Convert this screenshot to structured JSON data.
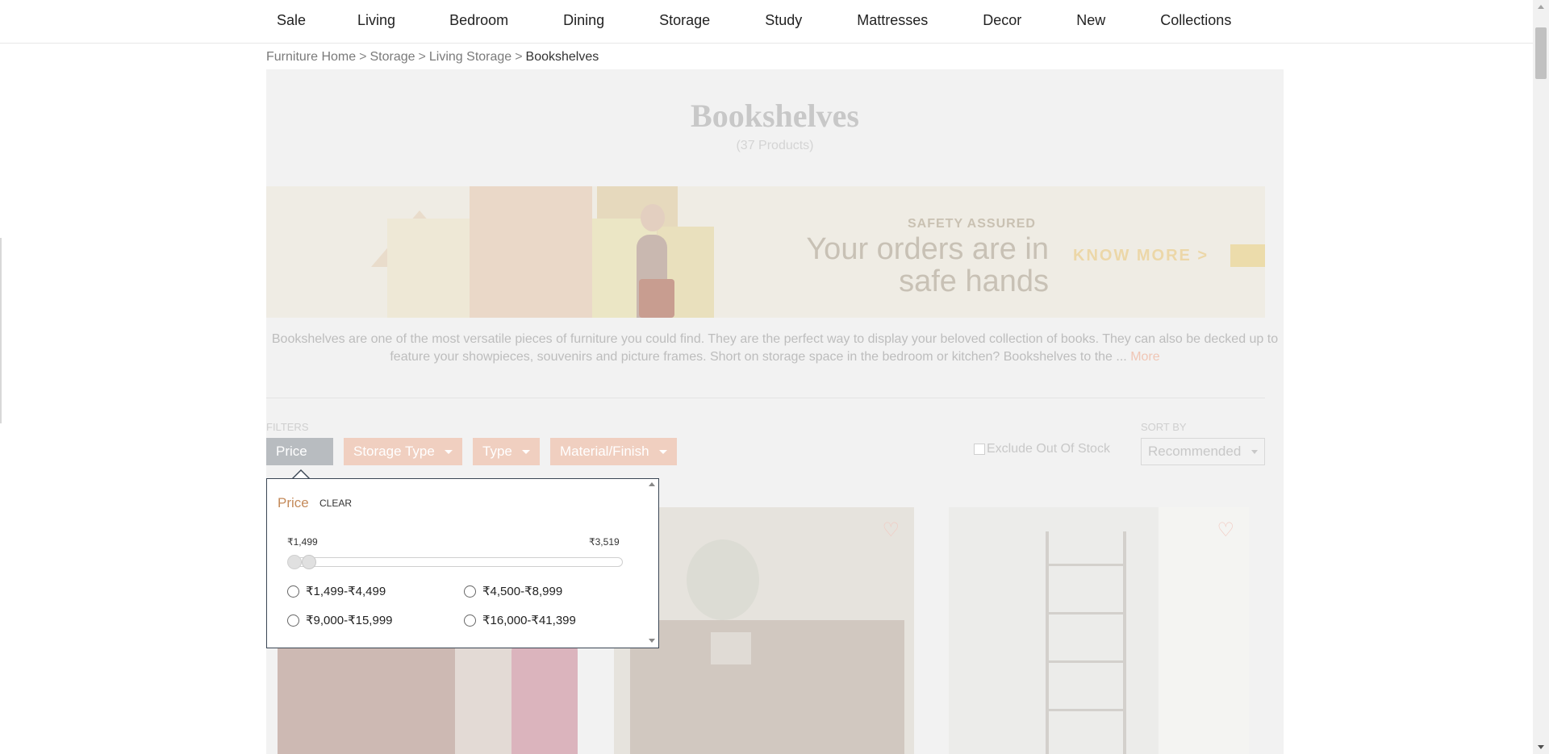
{
  "nav": {
    "items": [
      "Sale",
      "Living",
      "Bedroom",
      "Dining",
      "Storage",
      "Study",
      "Mattresses",
      "Decor",
      "New",
      "Collections"
    ]
  },
  "breadcrumb": {
    "items": [
      "Furniture Home",
      "Storage",
      "Living Storage"
    ],
    "separator": ">",
    "current": "Bookshelves"
  },
  "page": {
    "title": "Bookshelves",
    "count": "(37 Products)"
  },
  "banner": {
    "kicker": "SAFETY ASSURED",
    "headline_line1": "Your orders are in",
    "headline_line2": "safe hands",
    "cta": "KNOW MORE >"
  },
  "description": {
    "text": "Bookshelves are one of the most versatile pieces of furniture you could find. They are the perfect way to display your beloved collection of books. They can also be decked up to feature your showpieces, souvenirs and picture frames. Short on storage space in the bedroom or kitchen? Bookshelves to the ... ",
    "more": "More"
  },
  "filters": {
    "label": "FILTERS",
    "buttons": [
      "Price",
      "Storage Type",
      "Type",
      "Material/Finish"
    ],
    "exclude_out_of_stock": "Exclude Out Of Stock",
    "sort_label": "SORT BY",
    "sort_value": "Recommended"
  },
  "price_popup": {
    "title": "Price",
    "clear": "CLEAR",
    "min": "₹1,499",
    "max": "₹3,519",
    "options": [
      "₹1,499-₹4,499",
      "₹4,500-₹8,999",
      "₹9,000-₹15,999",
      "₹16,000-₹41,399"
    ]
  },
  "icons": {
    "heart": "heart-outline-icon",
    "caret": "caret-down-icon"
  },
  "colors": {
    "accent": "#c48a5a",
    "filter_active": "#f0cfc0",
    "filter_selected": "#b8bcc0",
    "popup_border": "#3a4654"
  }
}
